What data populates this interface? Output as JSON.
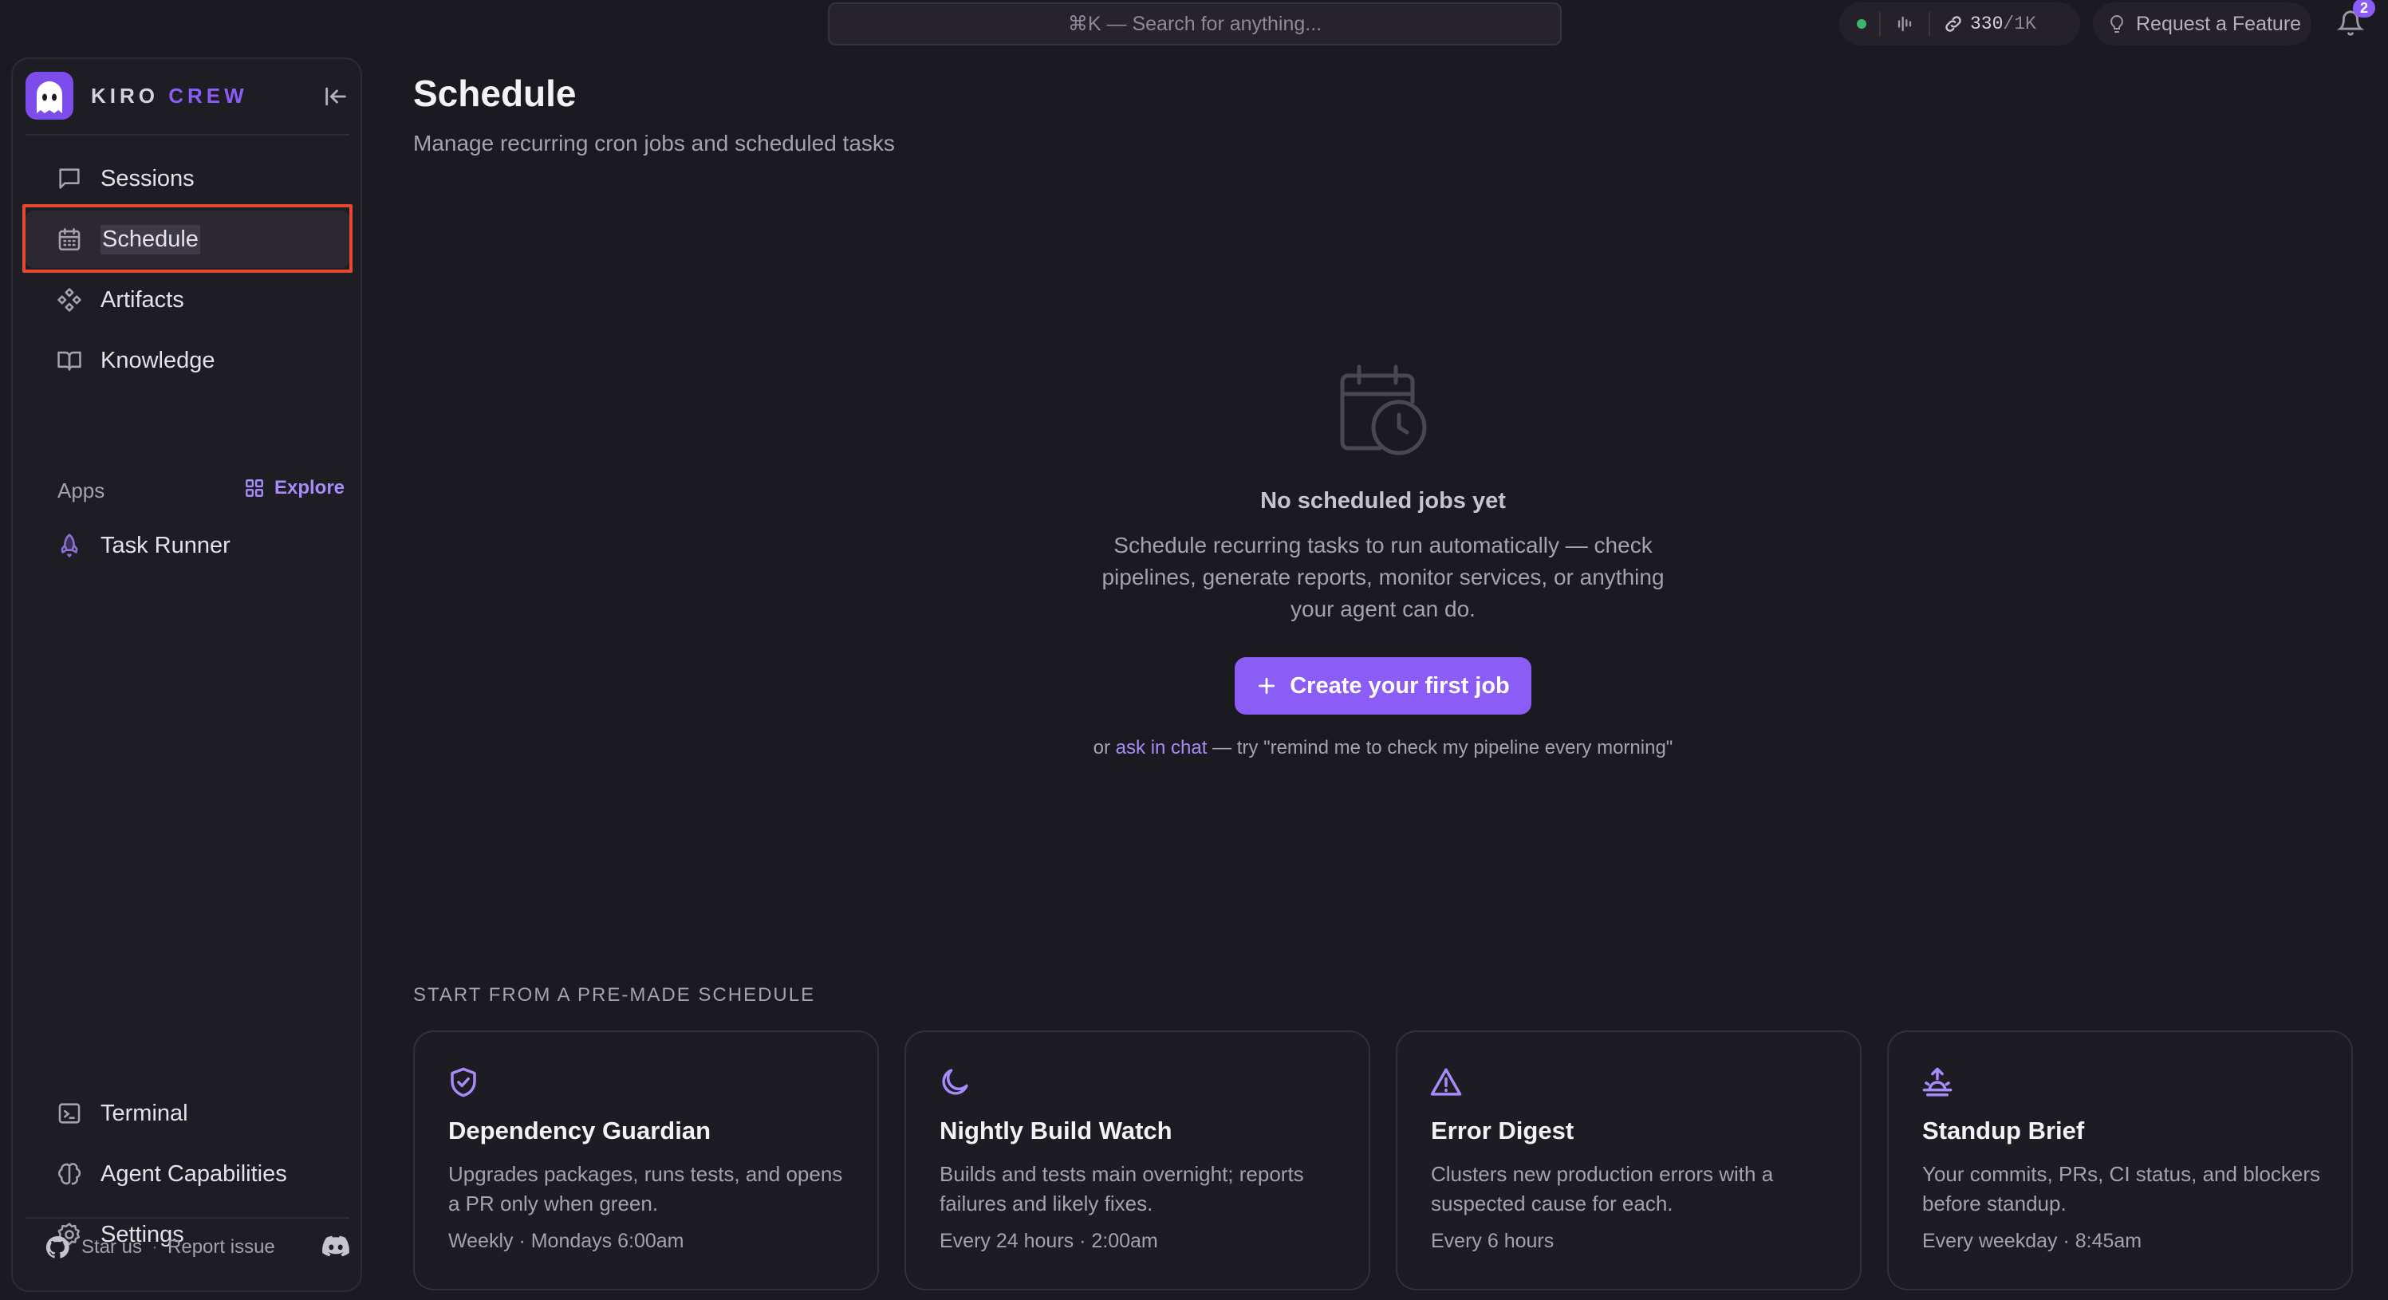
{
  "topbar": {
    "search_placeholder": "⌘K — Search for anything...",
    "quota_used": "330",
    "quota_max": "/1K",
    "request_feature": "Request a Feature",
    "notification_count": "2",
    "status_color": "#3eb36a"
  },
  "sidebar": {
    "brand_first": "KIRO",
    "brand_second": "CREW",
    "nav": [
      {
        "label": "Sessions",
        "icon": "chat-bubble-icon"
      },
      {
        "label": "Schedule",
        "icon": "calendar-icon",
        "active": true
      },
      {
        "label": "Artifacts",
        "icon": "components-icon"
      },
      {
        "label": "Knowledge",
        "icon": "book-icon"
      }
    ],
    "apps_label": "Apps",
    "explore_label": "Explore",
    "apps": [
      {
        "label": "Task Runner",
        "icon": "rocket-icon"
      }
    ],
    "bottom_nav": [
      {
        "label": "Terminal",
        "icon": "terminal-icon"
      },
      {
        "label": "Agent Capabilities",
        "icon": "brain-icon"
      },
      {
        "label": "Settings",
        "icon": "gear-icon"
      }
    ],
    "footer": {
      "star_label": "Star us",
      "separator": "·",
      "report_label": "Report issue"
    }
  },
  "main": {
    "title": "Schedule",
    "subtitle": "Manage recurring cron jobs and scheduled tasks",
    "empty": {
      "title": "No scheduled jobs yet",
      "description": "Schedule recurring tasks to run automatically — check pipelines, generate reports, monitor services, or anything your agent can do.",
      "button_label": "Create your first job",
      "hint_prefix": "or",
      "hint_link": "ask in chat",
      "hint_suffix": "— try \"remind me to check my pipeline every morning\""
    },
    "premade_label": "START FROM A PRE-MADE SCHEDULE",
    "templates": [
      {
        "title": "Dependency Guardian",
        "description": "Upgrades packages, runs tests, and opens a PR only when green.",
        "schedule": "Weekly · Mondays 6:00am",
        "icon": "shield-check-icon"
      },
      {
        "title": "Nightly Build Watch",
        "description": "Builds and tests main overnight; reports failures and likely fixes.",
        "schedule": "Every 24 hours · 2:00am",
        "icon": "moon-icon"
      },
      {
        "title": "Error Digest",
        "description": "Clusters new production errors with a suspected cause for each.",
        "schedule": "Every 6 hours",
        "icon": "warning-triangle-icon"
      },
      {
        "title": "Standup Brief",
        "description": "Your commits, PRs, CI status, and blockers before standup.",
        "schedule": "Every weekday · 8:45am",
        "icon": "sunrise-icon"
      }
    ]
  },
  "colors": {
    "accent": "#8b5cf6",
    "accent_light": "#a78bfa",
    "background": "#1c1a21",
    "highlight_outline": "#e6472f"
  }
}
